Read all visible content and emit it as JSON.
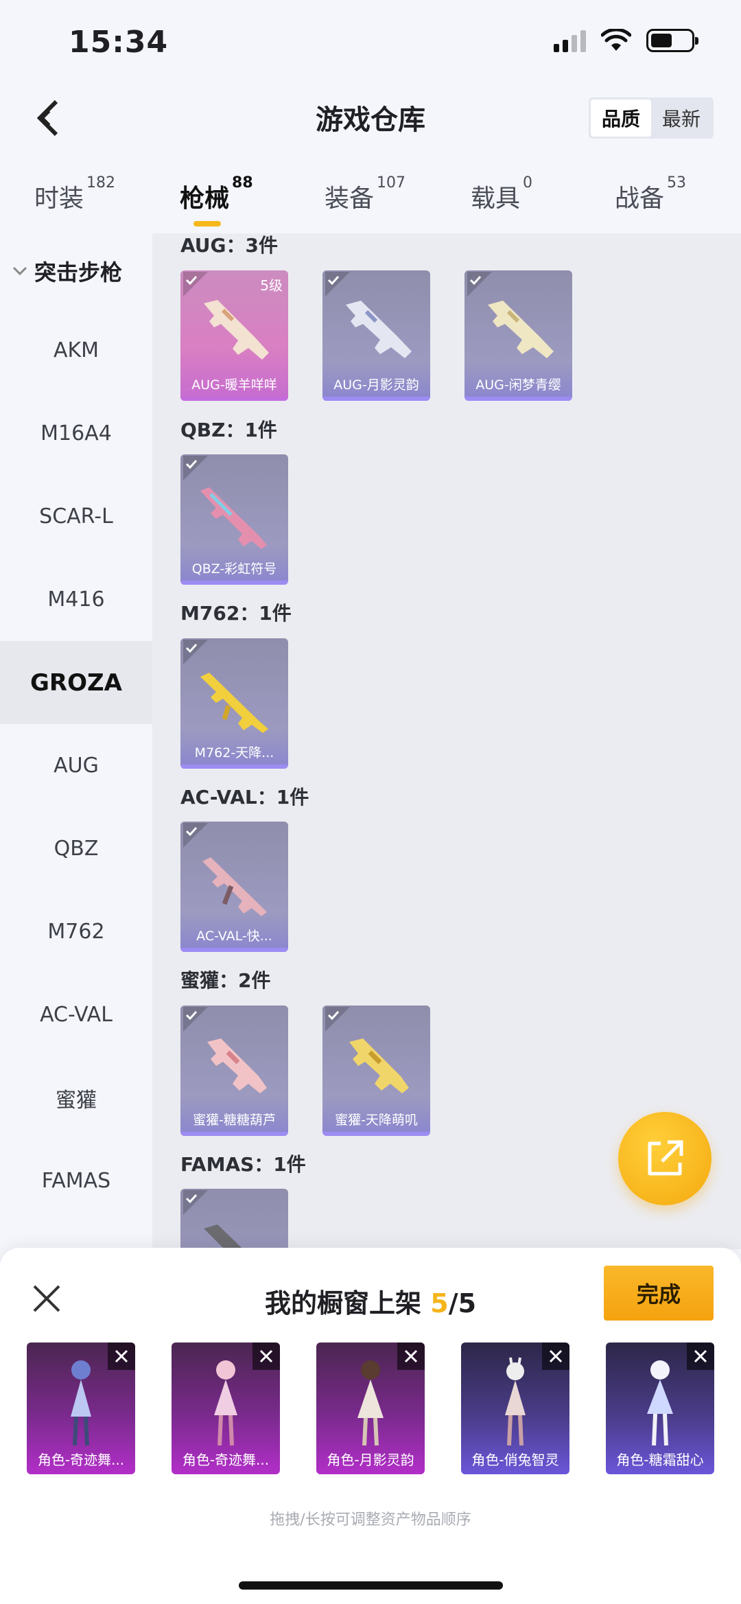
{
  "status_bar": {
    "time": "15:34"
  },
  "header": {
    "title": "游戏仓库",
    "sort_options": [
      "品质",
      "最新"
    ]
  },
  "tabs": [
    {
      "label": "时装",
      "count": "182"
    },
    {
      "label": "枪械",
      "count": "88"
    },
    {
      "label": "装备",
      "count": "107"
    },
    {
      "label": "载具",
      "count": "0"
    },
    {
      "label": "战备",
      "count": "53"
    }
  ],
  "sidebar": {
    "group": "突击步枪",
    "items": [
      "AKM",
      "M16A4",
      "SCAR-L",
      "M416",
      "GROZA",
      "AUG",
      "QBZ",
      "M762",
      "AC-VAL",
      "蜜獾",
      "FAMAS"
    ]
  },
  "sections": [
    {
      "title": "AUG：3件",
      "items": [
        {
          "name": "AUG-暖羊咩咩",
          "level": "5级",
          "rarity": "pink"
        },
        {
          "name": "AUG-月影灵韵",
          "rarity": "purple"
        },
        {
          "name": "AUG-闲梦青缨",
          "rarity": "purple"
        }
      ]
    },
    {
      "title": "QBZ：1件",
      "items": [
        {
          "name": "QBZ-彩虹符号",
          "rarity": "purple"
        }
      ]
    },
    {
      "title": "M762：1件",
      "items": [
        {
          "name": "M762-天降...",
          "rarity": "purple"
        }
      ]
    },
    {
      "title": "AC-VAL：1件",
      "items": [
        {
          "name": "AC-VAL-快...",
          "rarity": "purple"
        }
      ]
    },
    {
      "title": "蜜獾：2件",
      "items": [
        {
          "name": "蜜獾-糖糖葫芦",
          "rarity": "purple"
        },
        {
          "name": "蜜獾-天降萌叽",
          "rarity": "purple"
        }
      ]
    },
    {
      "title": "FAMAS：1件",
      "items": [
        {
          "name": "",
          "rarity": "purple"
        }
      ]
    }
  ],
  "showcase": {
    "title_prefix": "我的橱窗上架",
    "count": "5",
    "total": "/5",
    "done_label": "完成",
    "slots": [
      {
        "name": "角色-奇迹舞...",
        "style": "magenta"
      },
      {
        "name": "角色-奇迹舞...",
        "style": "magenta"
      },
      {
        "name": "角色-月影灵韵",
        "style": "magenta"
      },
      {
        "name": "角色-俏兔智灵",
        "style": "indigo"
      },
      {
        "name": "角色-糖霜甜心",
        "style": "indigo"
      }
    ],
    "hint": "拖拽/长按可调整资产物品顺序"
  },
  "colors": {
    "accent": "#f6b81b",
    "rare_purple": "#9d8cf3",
    "rare_pink": "#c46bdc"
  }
}
